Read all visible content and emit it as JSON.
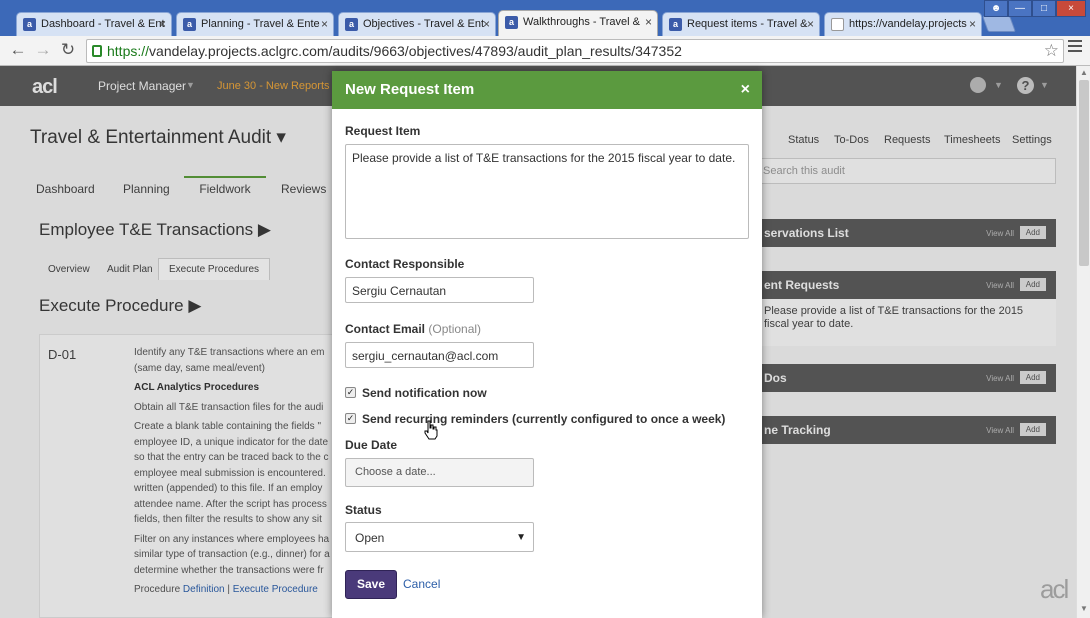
{
  "browser": {
    "tabs": [
      {
        "label": "Dashboard - Travel & Ent",
        "favicon": "aclgrc-icon"
      },
      {
        "label": "Planning - Travel & Ente",
        "favicon": "aclgrc-icon"
      },
      {
        "label": "Objectives - Travel & Ent",
        "favicon": "aclgrc-icon"
      },
      {
        "label": "Walkthroughs - Travel &",
        "favicon": "aclgrc-icon",
        "active": true
      },
      {
        "label": "Request items - Travel &",
        "favicon": "aclgrc-icon"
      },
      {
        "label": "https://vandelay.projects",
        "favicon": "document-icon"
      }
    ],
    "url_scheme": "https://",
    "url_host": "vandelay.projects.aclgrc.com",
    "url_path": "/audits/9663/objectives/47893/audit_plan_results/347352"
  },
  "app": {
    "logo": "acl",
    "menu": "Project Manager",
    "banner": "June 30 - New Reports M",
    "audit_title": "Travel & Entertainment Audit",
    "subnav": [
      "Dashboard",
      "Planning",
      "Fieldwork",
      "Reviews"
    ],
    "active_subnav": "Fieldwork",
    "right_links": [
      "Status",
      "To-Dos",
      "Requests",
      "Timesheets",
      "Settings"
    ],
    "search_placeholder": "Search this audit",
    "section_title": "Employee T&E Transactions",
    "mini_tabs": [
      "Overview",
      "Audit Plan",
      "Execute Procedures"
    ],
    "procedure_heading": "Execute Procedure",
    "procedure_id": "D-01",
    "procedure_lines": [
      "Identify any T&E transactions where an em",
      "(same day, same meal/event)",
      "ACL Analytics Procedures",
      "Obtain all T&E transaction files for the audi",
      "Create a blank table containing the fields \"",
      "employee ID, a unique indicator for the date",
      "so that the entry can be traced back to the c",
      "employee meal submission is encountered.",
      "written (appended) to this file. If an employ",
      "attendee name. After the script has process",
      "fields, then filter the results to show any sit",
      "Filter on any instances where employees ha",
      "similar type of transaction (e.g., dinner) for a",
      "determine whether the transactions were fr"
    ],
    "procedure_link_prefix": "Procedure",
    "procedure_link_def": "Definition",
    "procedure_link_sep": "|",
    "procedure_link_exec": "Execute Procedure",
    "panels": [
      {
        "title": "servations List",
        "view_all": "View All",
        "add": "Add",
        "body": ""
      },
      {
        "title": "ent Requests",
        "view_all": "View All",
        "add": "Add",
        "body": "Please provide a list of T&E transactions for the 2015 fiscal year to date."
      },
      {
        "title": "Dos",
        "view_all": "View All",
        "add": "Add",
        "body": ""
      },
      {
        "title": "ne Tracking",
        "view_all": "View All",
        "add": "Add",
        "body": ""
      }
    ],
    "footer_logo": "acl"
  },
  "modal": {
    "title": "New Request Item",
    "close": "×",
    "request_item_label": "Request Item",
    "request_item_value": "Please provide a list of T&E transactions for the 2015 fiscal year to date.",
    "contact_label": "Contact Responsible",
    "contact_value": "Sergiu Cernautan",
    "email_label": "Contact Email",
    "email_optional": "(Optional)",
    "email_value": "sergiu_cernautan@acl.com",
    "notify_label": "Send notification now",
    "notify_checked": true,
    "reminder_label": "Send recurring reminders (currently configured to once a week)",
    "reminder_checked": true,
    "due_label": "Due Date",
    "due_placeholder": "Choose a date...",
    "status_label": "Status",
    "status_value": "Open",
    "save": "Save",
    "cancel": "Cancel"
  },
  "colors": {
    "modal_header": "#5b9a3f",
    "save_button": "#4a3a7a",
    "app_nav": "#5b5b5b",
    "browser_frame": "#3c69b8",
    "link": "#2c5ea8",
    "banner": "#e8a33a"
  }
}
